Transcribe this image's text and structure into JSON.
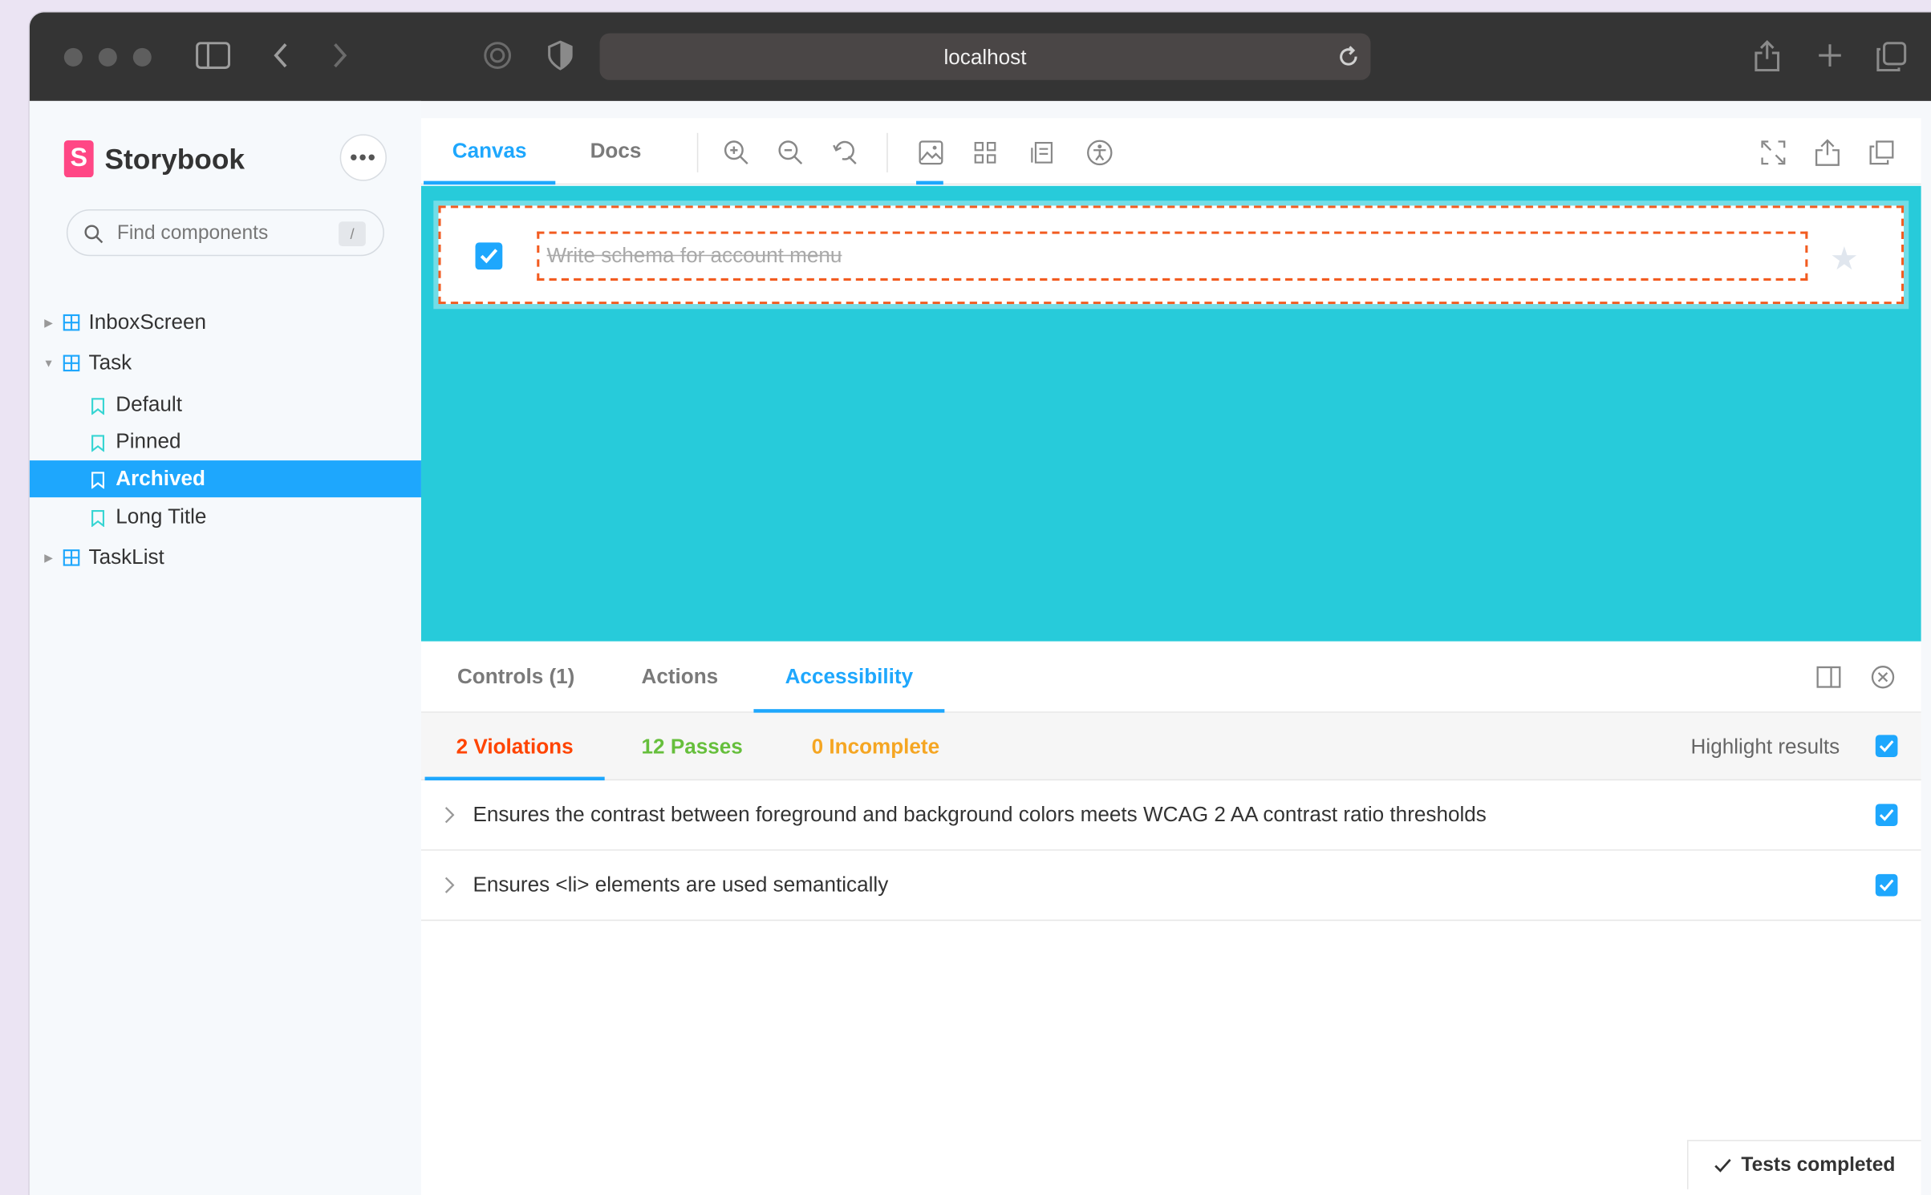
{
  "browser": {
    "url": "localhost"
  },
  "sidebar": {
    "brand": "Storybook",
    "menu_label": "•••",
    "search_placeholder": "Find components",
    "search_shortcut": "/",
    "items": [
      {
        "label": "InboxScreen",
        "type": "component",
        "expanded": false
      },
      {
        "label": "Task",
        "type": "component",
        "expanded": true
      },
      {
        "label": "Default",
        "type": "story"
      },
      {
        "label": "Pinned",
        "type": "story"
      },
      {
        "label": "Archived",
        "type": "story",
        "selected": true
      },
      {
        "label": "Long Title",
        "type": "story"
      },
      {
        "label": "TaskList",
        "type": "component",
        "expanded": false
      }
    ]
  },
  "toolbar": {
    "tabs": [
      "Canvas",
      "Docs"
    ],
    "active_tab": "Canvas"
  },
  "canvas": {
    "background": "#27cbda",
    "task_title": "Write schema for account menu",
    "task_checked": true
  },
  "addons": {
    "tabs": [
      "Controls (1)",
      "Actions",
      "Accessibility"
    ],
    "active_tab": "Accessibility"
  },
  "a11y": {
    "violations_label": "2 Violations",
    "passes_label": "12 Passes",
    "incomplete_label": "0 Incomplete",
    "highlight_label": "Highlight results",
    "rules": [
      "Ensures the contrast between foreground and background colors meets WCAG 2 AA contrast ratio thresholds",
      "Ensures <li> elements are used semantically"
    ]
  },
  "status": {
    "tests_completed": "Tests completed"
  },
  "colors": {
    "accent": "#1ea7fd",
    "violation": "#ff4400",
    "pass": "#66bf3c",
    "incomplete": "#f5a623",
    "storybook_pink": "#ff4785"
  }
}
